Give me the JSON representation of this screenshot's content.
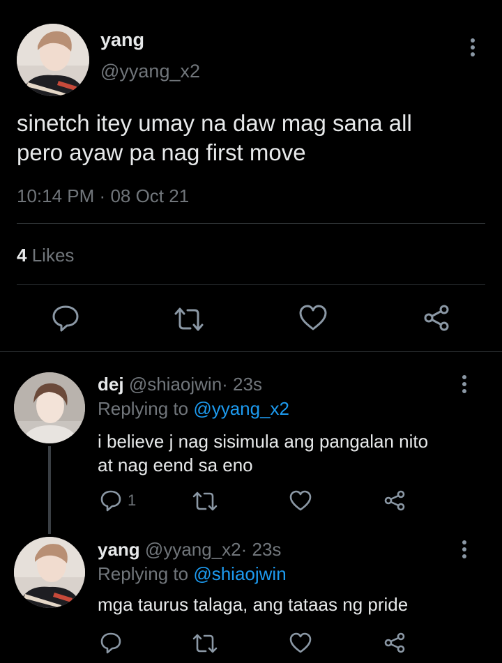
{
  "main_tweet": {
    "display_name": "yang",
    "handle": "@yyang_x2",
    "text_line1": "sinetch itey umay na daw mag sana all",
    "text_line2": "pero ayaw pa nag first move",
    "time": "10:14 PM",
    "date_sep": "·",
    "date": "08 Oct 21",
    "likes_count": "4",
    "likes_label": "Likes"
  },
  "replies": [
    {
      "display_name": "dej",
      "handle": "@shiaojwin",
      "age": "· 23s",
      "replying_prefix": "Replying to",
      "replying_to": "@yyang_x2",
      "text_line1": "i believe j nag sisimula ang pangalan nito",
      "text_line2": "at nag eend sa eno",
      "reply_count": "1"
    },
    {
      "display_name": "yang",
      "handle": "@yyang_x2",
      "age": "· 23s",
      "replying_prefix": "Replying to",
      "replying_to": "@shiaojwin",
      "text_line1": "mga taurus talaga, ang tataas ng pride",
      "reply_count": ""
    }
  ],
  "colors": {
    "background": "#000000",
    "text": "#e7e9ea",
    "muted": "#71767b",
    "link": "#1d9bf0",
    "divider": "#2f3336"
  },
  "icons": [
    "reply-icon",
    "retweet-icon",
    "like-icon",
    "share-icon",
    "more-options-icon"
  ]
}
